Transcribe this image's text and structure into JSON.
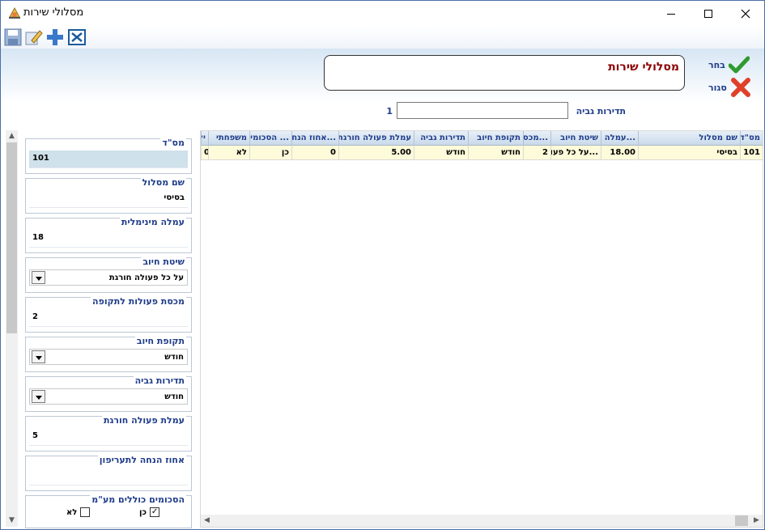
{
  "window": {
    "title": "מסלולי שירות"
  },
  "toolbar": {
    "icons": [
      "save-icon",
      "edit-icon",
      "add-icon",
      "excel-icon"
    ]
  },
  "header": {
    "page_title": "מסלולי שירות",
    "choose_label": "בחר",
    "close_label": "סגור",
    "frequency_label": "תדירות גביה",
    "frequency_value": "",
    "record_count": "1"
  },
  "form": {
    "id_label": "מס\"ד",
    "id_value": "101",
    "name_label": "שם מסלול",
    "name_value": "בסיסי",
    "min_fee_label": "עמלה מינימלית",
    "min_fee_value": "18",
    "billing_method_label": "שיטת חיוב",
    "billing_method_value": "על כל פעולה חורגת",
    "quota_label": "מכסת פעולות לתקופה",
    "quota_value": "2",
    "billing_period_label": "תקופת חיוב",
    "billing_period_value": "חודש",
    "collection_freq_label": "תדירות גביה",
    "collection_freq_value": "חודש",
    "excess_fee_label": "עמלת פעולה חורגת",
    "excess_fee_value": "5",
    "discount_label": "אחוז הנחה לתעריפון",
    "discount_value": "",
    "family_label": "הסכומים כוללים מע\"מ",
    "yes_label": "כן",
    "no_label": "לא",
    "yes_checked": "✓",
    "no_checked": ""
  },
  "grid": {
    "headers": [
      "מס\"ד",
      "שם מסלול",
      "...עמלה מ",
      "שיטת חיוב",
      "...מכס",
      "תקופת חיוב",
      "תדירות גביה",
      "עמלת פעולה חורגת",
      "...אחוז הנח",
      "... הסכומים",
      "משפחתי",
      "יל"
    ],
    "rows": [
      [
        "101",
        "בסיסי",
        "18.00",
        "...על כל פעול",
        "2",
        "חודש",
        "חודש",
        "5.00",
        "0",
        "כן",
        "לא",
        "0"
      ]
    ]
  }
}
